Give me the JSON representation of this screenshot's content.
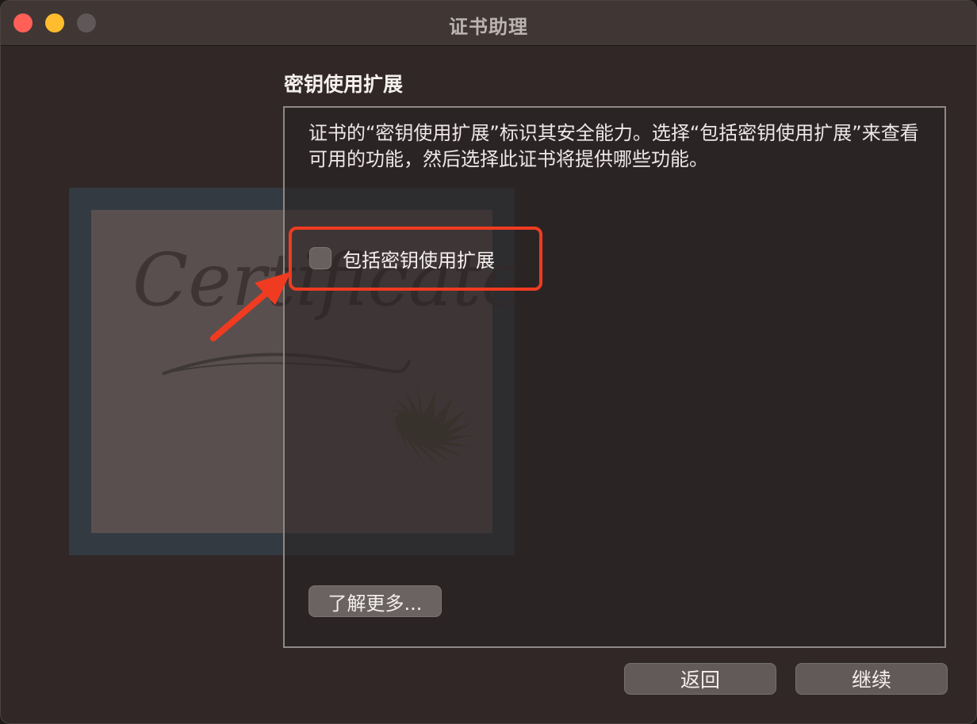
{
  "window": {
    "title": "证书助理",
    "traffic_lights": {
      "close_color": "#fe5f57",
      "minimize_color": "#febc2e",
      "zoom_color": "#5f5858"
    }
  },
  "illustration": {
    "certificate_script": "Certificate"
  },
  "main": {
    "section_title": "密钥使用扩展",
    "description": "证书的“密钥使用扩展”标识其安全能力。选择“包括密钥使用扩展”来查看可用的功能，然后选择此证书将提供哪些功能。",
    "checkbox": {
      "label": "包括密钥使用扩展",
      "checked": false
    },
    "learn_more_label": "了解更多..."
  },
  "footer": {
    "back_label": "返回",
    "continue_label": "继续"
  },
  "annotation": {
    "highlight_color": "#f03b20"
  }
}
